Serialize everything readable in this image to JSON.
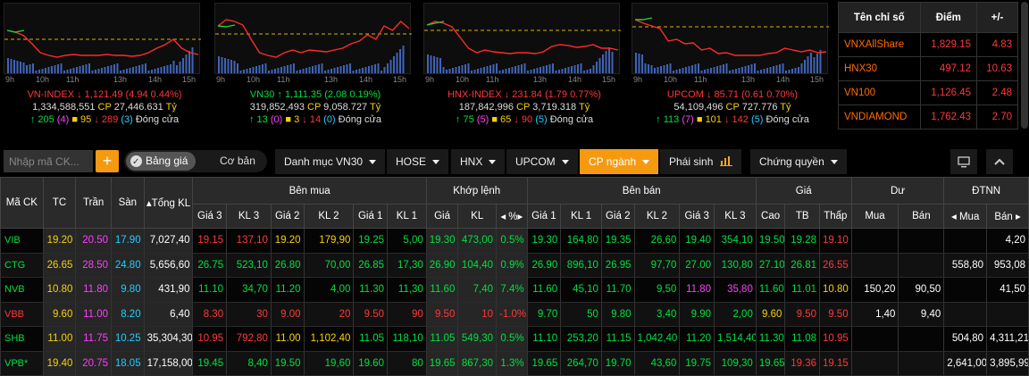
{
  "indices": [
    {
      "name": "VN-INDEX",
      "arrow": "↓",
      "dir": "down",
      "value": "1,121.49",
      "change": "(4.94 0.44%)",
      "volume": "1,334,588,551",
      "cp_label": "CP",
      "cp_value": "27,446.631",
      "unit": "Tỷ",
      "up_count": "205",
      "ceil_count": "(4)",
      "ref_count": "95",
      "down_count": "289",
      "floor_count": "(3)",
      "status": "Đóng cửa",
      "times": [
        "9h",
        "10h",
        "11h",
        "13h",
        "14h",
        "15h"
      ]
    },
    {
      "name": "VN30",
      "arrow": "↑",
      "dir": "up",
      "value": "1,111.35",
      "change": "(2.08 0.19%)",
      "volume": "319,852,493",
      "cp_label": "CP",
      "cp_value": "9,058.727",
      "unit": "Tỷ",
      "up_count": "13",
      "ceil_count": "(0)",
      "ref_count": "3",
      "down_count": "14",
      "floor_count": "(0)",
      "status": "Đóng cửa",
      "times": [
        "9h",
        "10h",
        "11h",
        "13h",
        "14h",
        "15h"
      ]
    },
    {
      "name": "HNX-INDEX",
      "arrow": "↓",
      "dir": "down",
      "value": "231.84",
      "change": "(1.79 0.77%)",
      "volume": "187,842,996",
      "cp_label": "CP",
      "cp_value": "3,719.318",
      "unit": "Tỷ",
      "up_count": "75",
      "ceil_count": "(5)",
      "ref_count": "65",
      "down_count": "90",
      "floor_count": "(5)",
      "status": "Đóng cửa",
      "times": [
        "9h",
        "10h",
        "11h",
        "13h",
        "14h",
        "15h"
      ]
    },
    {
      "name": "UPCOM",
      "arrow": "↓",
      "dir": "down",
      "value": "85.71",
      "change": "(0.61 0.70%)",
      "volume": "54,109,496",
      "cp_label": "CP",
      "cp_value": "727.776",
      "unit": "Tỷ",
      "up_count": "113",
      "ceil_count": "(7)",
      "ref_count": "101",
      "down_count": "142",
      "floor_count": "(5)",
      "status": "Đóng cửa",
      "times": [
        "9h",
        "10h",
        "11h",
        "13h",
        "14h",
        "15h"
      ]
    }
  ],
  "summary": {
    "headers": [
      "Tên chỉ số",
      "Điểm",
      "+/-"
    ],
    "rows": [
      {
        "name": "VNXAllShare",
        "point": "1,829.15",
        "change": "4.83"
      },
      {
        "name": "HNX30",
        "point": "497.12",
        "change": "10.63"
      },
      {
        "name": "VN100",
        "point": "1,126.45",
        "change": "2.48"
      },
      {
        "name": "VNDIAMOND",
        "point": "1,762.43",
        "change": "2.70"
      }
    ]
  },
  "toolbar": {
    "search_placeholder": "Nhập mã CK...",
    "add_label": "+",
    "toggle_on": "Bảng giá",
    "toggle_off": "Cơ bản",
    "tabs": [
      "Danh mục VN30",
      "HOSE",
      "HNX",
      "UPCOM",
      "CP ngành",
      "Phái sinh",
      "Chứng quyền"
    ],
    "active_tab": "CP ngành"
  },
  "board": {
    "group_headers": {
      "code": "Mã CK",
      "ref": "TC",
      "ceil": "Trần",
      "floor": "Sàn",
      "total": "▴Tổng KL",
      "buy": "Bên mua",
      "match": "Khớp lệnh",
      "sell": "Bên bán",
      "price": "Giá",
      "remain": "Dư",
      "foreign": "ĐTNN"
    },
    "sub_headers": [
      "Giá 3",
      "KL 3",
      "Giá 2",
      "KL 2",
      "Giá 1",
      "KL 1",
      "Giá",
      "KL",
      "◂ %▸",
      "Giá 1",
      "KL 1",
      "Giá 2",
      "KL 2",
      "Giá 3",
      "KL 3",
      "Cao",
      "TB",
      "Thấp",
      "Mua",
      "Bán",
      "◂ Mua",
      "Bán ▸"
    ],
    "rows": [
      {
        "code": "VIB",
        "cc": "green",
        "cells": [
          "19.20",
          "20.50",
          "17.90",
          "7,027,40",
          "19.15",
          "137,10",
          "19.20",
          "179,90",
          "19.25",
          "5,00",
          "19.30",
          "473,00",
          "0.5%",
          "19.30",
          "164,80",
          "19.35",
          "26,60",
          "19.40",
          "354,10",
          "19.50",
          "19.28",
          "19.10",
          "",
          "",
          "",
          "4,20"
        ],
        "colors": [
          "yellow",
          "purple",
          "cyan",
          "white",
          "red",
          "red",
          "yellow",
          "yellow",
          "green",
          "green",
          "green",
          "green",
          "green",
          "green",
          "green",
          "green",
          "green",
          "green",
          "green",
          "green",
          "green",
          "red",
          "white",
          "white",
          "white",
          "white"
        ]
      },
      {
        "code": "CTG",
        "cc": "green",
        "cells": [
          "26.65",
          "28.50",
          "24.80",
          "5,656,60",
          "26.75",
          "523,10",
          "26.80",
          "70,00",
          "26.85",
          "17,30",
          "26.90",
          "104,40",
          "0.9%",
          "26.90",
          "896,10",
          "26.95",
          "97,70",
          "27.00",
          "130,80",
          "27.10",
          "26.81",
          "26.55",
          "",
          "",
          "558,80",
          "953,08"
        ],
        "colors": [
          "yellow",
          "purple",
          "cyan",
          "white",
          "green",
          "green",
          "green",
          "green",
          "green",
          "green",
          "green",
          "green",
          "green",
          "green",
          "green",
          "green",
          "green",
          "green",
          "green",
          "green",
          "green",
          "red",
          "white",
          "white",
          "white",
          "white"
        ]
      },
      {
        "code": "NVB",
        "cc": "green",
        "cells": [
          "10.80",
          "11.80",
          "9.80",
          "431,90",
          "11.10",
          "34,70",
          "11.20",
          "4,00",
          "11.30",
          "11,30",
          "11.60",
          "7,40",
          "7.4%",
          "11.60",
          "45,10",
          "11.70",
          "9,50",
          "11.80",
          "35,80",
          "11.60",
          "11.01",
          "10.80",
          "150,20",
          "90,50",
          "",
          "41,50"
        ],
        "colors": [
          "yellow",
          "purple",
          "cyan",
          "white",
          "green",
          "green",
          "green",
          "green",
          "green",
          "green",
          "green",
          "green",
          "green",
          "green",
          "green",
          "green",
          "green",
          "purple",
          "purple",
          "green",
          "green",
          "yellow",
          "white",
          "white",
          "white",
          "white"
        ]
      },
      {
        "code": "VBB",
        "cc": "red",
        "cells": [
          "9.60",
          "11.00",
          "8.20",
          "6,40",
          "8.30",
          "30",
          "9.00",
          "20",
          "9.50",
          "90",
          "9.50",
          "10",
          "-1.0%",
          "9.70",
          "50",
          "9.80",
          "3,40",
          "9.90",
          "2,00",
          "9.60",
          "9.50",
          "9.50",
          "1,40",
          "9,40",
          "",
          ""
        ],
        "colors": [
          "yellow",
          "purple",
          "cyan",
          "white",
          "red",
          "red",
          "red",
          "red",
          "red",
          "red",
          "red",
          "red",
          "red",
          "green",
          "green",
          "green",
          "green",
          "green",
          "green",
          "yellow",
          "red",
          "red",
          "white",
          "white",
          "white",
          "white"
        ]
      },
      {
        "code": "SHB",
        "cc": "green",
        "cells": [
          "11.00",
          "11.75",
          "10.25",
          "35,304,30",
          "10.95",
          "792,80",
          "11.00",
          "1,102,40",
          "11.05",
          "118,10",
          "11.05",
          "549,30",
          "0.5%",
          "11.10",
          "253,20",
          "11.15",
          "1,042,40",
          "11.20",
          "1,514,40",
          "11.30",
          "11.08",
          "10.95",
          "",
          "",
          "504,80",
          "4,311,21"
        ],
        "colors": [
          "yellow",
          "purple",
          "cyan",
          "white",
          "red",
          "red",
          "yellow",
          "yellow",
          "green",
          "green",
          "green",
          "green",
          "green",
          "green",
          "green",
          "green",
          "green",
          "green",
          "green",
          "green",
          "green",
          "red",
          "white",
          "white",
          "white",
          "white"
        ]
      },
      {
        "code": "VPB*",
        "cc": "green",
        "cells": [
          "19.40",
          "20.75",
          "18.05",
          "17,158,00",
          "19.45",
          "8,40",
          "19.50",
          "19,60",
          "19.60",
          "80",
          "19.65",
          "867,30",
          "1.3%",
          "19.65",
          "264,70",
          "19.70",
          "43,60",
          "19.75",
          "109,30",
          "19.65",
          "19.36",
          "19.15",
          "",
          "",
          "2,641,00",
          "3,895,99"
        ],
        "colors": [
          "yellow",
          "purple",
          "cyan",
          "white",
          "green",
          "green",
          "green",
          "green",
          "green",
          "green",
          "green",
          "green",
          "green",
          "green",
          "green",
          "green",
          "green",
          "green",
          "green",
          "green",
          "red",
          "red",
          "white",
          "white",
          "white",
          "white"
        ]
      }
    ]
  },
  "colors": {
    "up": "#00e040",
    "down": "#ff3737",
    "ref": "#f5d20a",
    "ceil": "#ff3dff",
    "floor": "#22ccff",
    "accent": "#f59a10"
  }
}
